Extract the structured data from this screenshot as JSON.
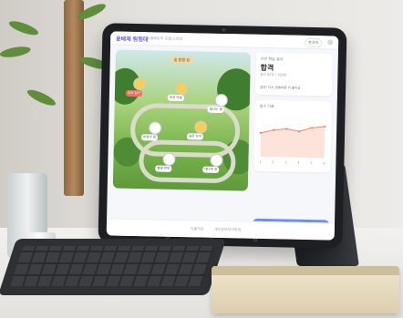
{
  "app": {
    "title": "윤배제 탐험대",
    "subtitle": "완두콩배트의 모험 스토리",
    "lang": "한국어",
    "map_banner": "숲 탐험 길",
    "map_nodes": [
      "숲속 입구",
      "버섯 마을",
      "빛나는 샘",
      "부엉이 집",
      "숨은 보석",
      "별빛 언덕",
      "대나무 길"
    ],
    "next_label": "다음 단계 보기 →",
    "footer_left": "이용약관",
    "footer_right": "개인정보처리방침"
  },
  "result_card": {
    "label": "이번 학습 결과",
    "value": "합격",
    "detail": "점수 82점 / 100점",
    "option": "잠깐! 다시 연습하면 더 좋아요"
  },
  "chart_data": {
    "type": "line",
    "title": "점수 기록",
    "x": [
      "1",
      "2",
      "3",
      "4",
      "5",
      "6"
    ],
    "values": [
      62,
      70,
      74,
      68,
      78,
      82
    ],
    "ylim": [
      0,
      100
    ],
    "color": "#f08a70"
  },
  "nav_icons": [
    "back-icon",
    "home-icon",
    "recent-icon"
  ]
}
